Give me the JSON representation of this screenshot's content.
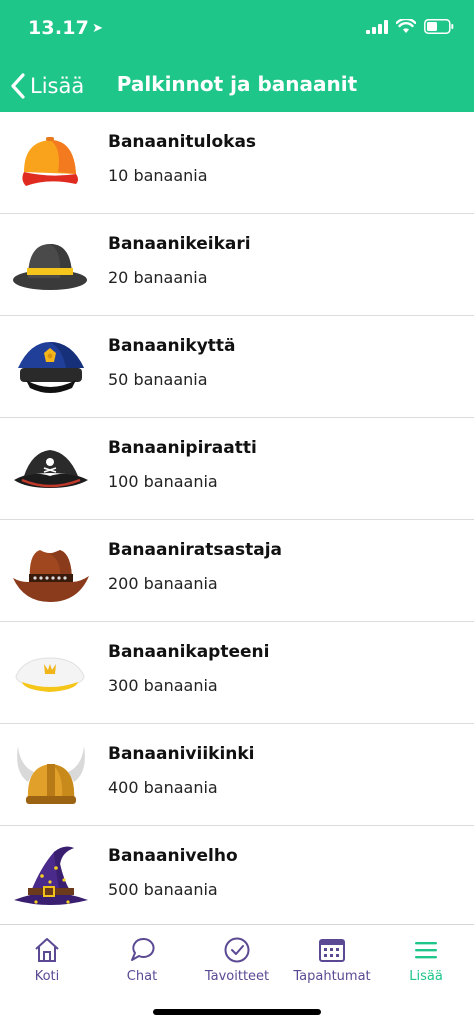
{
  "status": {
    "time": "13.17"
  },
  "nav": {
    "back_label": "Lisää",
    "title": "Palkinnot ja banaanit"
  },
  "rewards": [
    {
      "name": "Banaanitulokas",
      "price": "10 banaania",
      "icon": "cap-icon"
    },
    {
      "name": "Banaanikeikari",
      "price": "20 banaania",
      "icon": "bowler-hat-icon"
    },
    {
      "name": "Banaanikyttä",
      "price": "50 banaania",
      "icon": "police-cap-icon"
    },
    {
      "name": "Banaanipiraatti",
      "price": "100 banaania",
      "icon": "pirate-hat-icon"
    },
    {
      "name": "Banaaniratsastaja",
      "price": "200 banaania",
      "icon": "cowboy-hat-icon"
    },
    {
      "name": "Banaanikapteeni",
      "price": "300 banaania",
      "icon": "captain-hat-icon"
    },
    {
      "name": "Banaaniviikinki",
      "price": "400 banaania",
      "icon": "viking-helmet-icon"
    },
    {
      "name": "Banaanivelho",
      "price": "500 banaania",
      "icon": "wizard-hat-icon"
    }
  ],
  "tabs": [
    {
      "label": "Koti",
      "icon": "home-icon"
    },
    {
      "label": "Chat",
      "icon": "chat-icon"
    },
    {
      "label": "Tavoitteet",
      "icon": "check-circle-icon"
    },
    {
      "label": "Tapahtumat",
      "icon": "calendar-icon"
    },
    {
      "label": "Lisää",
      "icon": "menu-icon",
      "active": true
    }
  ],
  "colors": {
    "brand": "#1fc68a",
    "tab_inactive": "#5b4a93",
    "tab_active": "#1fc68a"
  }
}
